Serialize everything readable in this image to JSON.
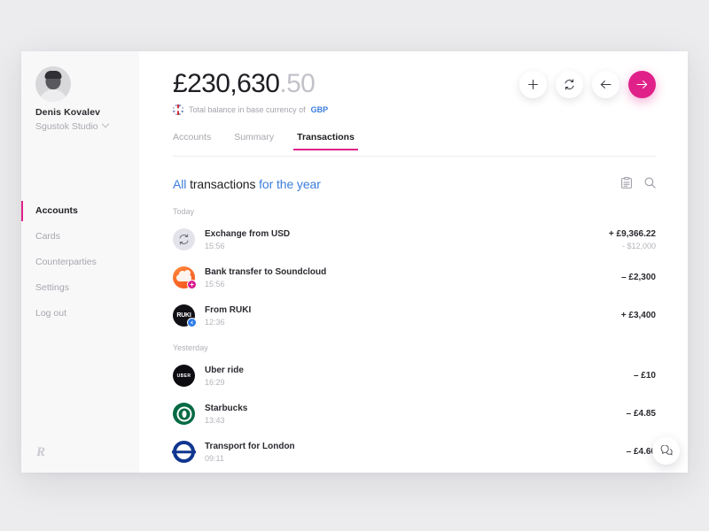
{
  "sidebar": {
    "user": {
      "name": "Denis Kovalev",
      "org": "Sgustok Studio"
    },
    "items": [
      {
        "label": "Accounts"
      },
      {
        "label": "Cards"
      },
      {
        "label": "Counterparties"
      },
      {
        "label": "Settings"
      },
      {
        "label": "Log out"
      }
    ],
    "brand_logo": "R"
  },
  "header": {
    "balance_main": "£230,630",
    "balance_cents": ".50",
    "subtitle_prefix": "Total balance in base currency of",
    "subtitle_currency": "GBP",
    "actions": [
      {
        "name": "add-button",
        "icon": "plus-icon"
      },
      {
        "name": "exchange-button",
        "icon": "refresh-icon"
      },
      {
        "name": "receive-button",
        "icon": "arrow-left-icon"
      },
      {
        "name": "send-button",
        "icon": "arrow-right-icon"
      }
    ]
  },
  "tabs": [
    {
      "label": "Accounts",
      "active": false
    },
    {
      "label": "Summary",
      "active": false
    },
    {
      "label": "Transactions",
      "active": true
    }
  ],
  "section": {
    "head_part1": "All ",
    "head_part2": "transactions ",
    "head_part3": "for the year",
    "statement_icon": "list-icon",
    "search_icon": "search-icon"
  },
  "groups": [
    {
      "label": "Today",
      "rows": [
        {
          "title": "Exchange from USD",
          "time": "15:56",
          "amount": "+ £9,366.22",
          "amount_sub": "- $12,000",
          "icon": "exchange-icon"
        },
        {
          "title": "Bank transfer to Soundcloud",
          "time": "15:56",
          "amount": "– £2,300",
          "amount_sub": "",
          "icon": "soundcloud-icon"
        },
        {
          "title": "From RUKI",
          "time": "12:36",
          "amount": "+ £3,400",
          "amount_sub": "",
          "icon": "ruki-icon"
        }
      ]
    },
    {
      "label": "Yesterday",
      "rows": [
        {
          "title": "Uber ride",
          "time": "16:29",
          "amount": "– £10",
          "amount_sub": "",
          "icon": "uber-icon"
        },
        {
          "title": "Starbucks",
          "time": "13:43",
          "amount": "– £4.85",
          "amount_sub": "",
          "icon": "starbucks-icon"
        },
        {
          "title": "Transport for London",
          "time": "09:11",
          "amount": "– £4.60",
          "amount_sub": "",
          "icon": "tfl-icon"
        }
      ]
    }
  ],
  "fab": {
    "icon": "chat-icon"
  },
  "colors": {
    "accent": "#e0218a",
    "link": "#3b7ddd",
    "text": "#1f1f24",
    "muted": "#b0b0b7"
  }
}
